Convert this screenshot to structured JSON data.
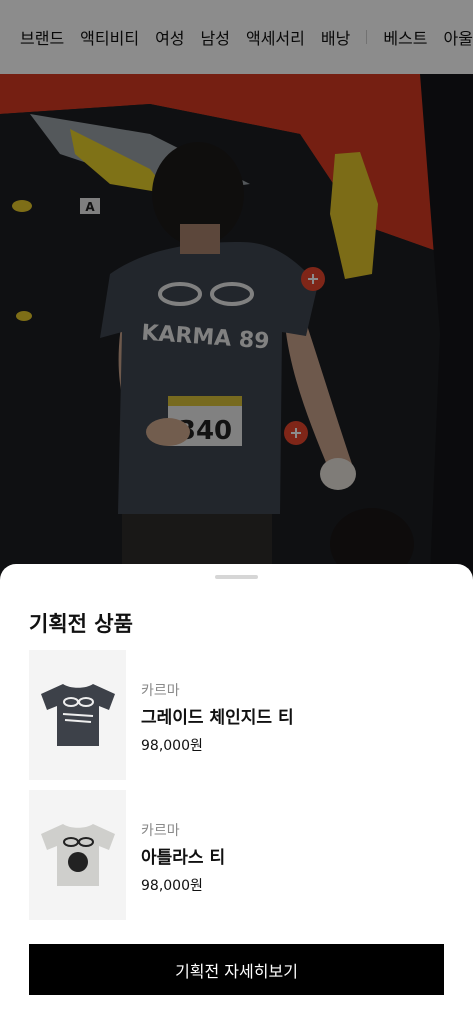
{
  "nav": {
    "items": [
      "브랜드",
      "액티비티",
      "여성",
      "남성",
      "액세서리",
      "배낭"
    ],
    "extra_items": [
      "베스트",
      "아울"
    ]
  },
  "hero": {
    "shirt_text": "KARMA 89",
    "bib_number": "340",
    "hold_label": "A",
    "hotspot_icon": "plus-circle-icon",
    "accent_color": "#e8452c"
  },
  "sheet": {
    "title": "기획전 상품",
    "products": [
      {
        "brand": "카르마",
        "name": "그레이드 체인지드 티",
        "price": "98,000원",
        "color": "#3d4149"
      },
      {
        "brand": "카르마",
        "name": "아틀라스 티",
        "price": "98,000원",
        "color": "#c9c9c6"
      }
    ],
    "cta_label": "기획전 자세히보기"
  }
}
